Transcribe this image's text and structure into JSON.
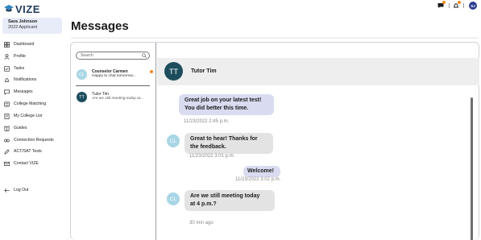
{
  "app": {
    "logo_text": "VIZE"
  },
  "user": {
    "name": "Sara Johnson",
    "subtitle": "2022 Applicant",
    "initials": "SJ"
  },
  "nav": [
    {
      "label": "Dashboard",
      "icon": "grid-icon"
    },
    {
      "label": "Profile",
      "icon": "person-icon"
    },
    {
      "label": "Tasks",
      "icon": "tasks-icon"
    },
    {
      "label": "Notifications",
      "icon": "bell-icon"
    },
    {
      "label": "Messages",
      "icon": "message-icon"
    },
    {
      "label": "College Matching",
      "icon": "match-icon"
    },
    {
      "label": "My College List",
      "icon": "list-icon"
    },
    {
      "label": "Guides",
      "icon": "book-icon"
    },
    {
      "label": "Connection Requests",
      "icon": "connection-icon"
    },
    {
      "label": "ACT/SAT Tests",
      "icon": "pencil-icon"
    },
    {
      "label": "Contact VIZE",
      "icon": "mail-icon"
    }
  ],
  "logout": {
    "label": "Log Out"
  },
  "page": {
    "title": "Messages"
  },
  "search": {
    "placeholder": "Search"
  },
  "conversations": [
    {
      "initials": "CL",
      "name": "Counselor Carmen",
      "preview": "Happy to chat tomorrow...",
      "unread": true
    },
    {
      "initials": "TT",
      "name": "Tutor Tim",
      "preview": "Are we still meeting today at...",
      "unread": false
    }
  ],
  "chat": {
    "contact_initials": "TT",
    "contact_name": "Tutor Tim",
    "messages": [
      {
        "text_lines": [
          "Great job on your latest test!",
          "You did better this time."
        ],
        "time": "11/23/2022 2:45 p.m.",
        "sender": "tutor"
      },
      {
        "avatar": "CL",
        "text_lines": [
          "Great to hear! Thanks for",
          "the feedback."
        ],
        "time": "11/23/2022 3:01 p.m.",
        "sender": "me"
      },
      {
        "text_lines": [
          "Welcome!"
        ],
        "time": "11/23/2022 3:02 p.m.",
        "sender": "tutor"
      },
      {
        "avatar": "CL",
        "text_lines": [
          "Are we still meeting today",
          "at 4 p.m.?"
        ],
        "time": "30 min ago",
        "sender": "me"
      }
    ]
  },
  "colors": {
    "accent_orange": "#f08a1c",
    "navy": "#2c3e91",
    "teal_avatar": "#1d4d5c",
    "light_blue_avatar": "#a9d6e5",
    "user_card_bg": "#e8ecf8"
  }
}
